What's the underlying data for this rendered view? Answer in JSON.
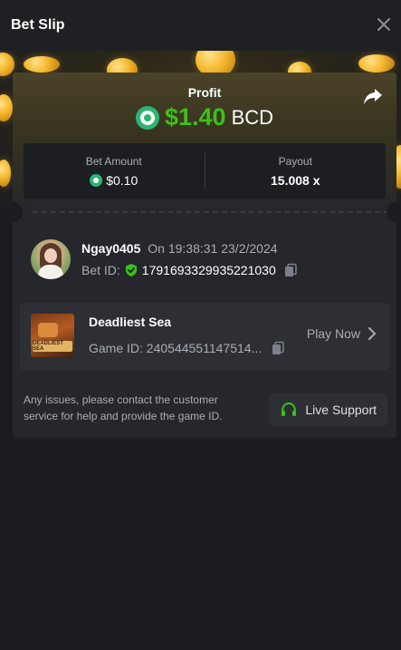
{
  "header": {
    "title": "Bet Slip"
  },
  "profit": {
    "label": "Profit",
    "value": "$1.40",
    "currency": "BCD"
  },
  "stats": {
    "bet_amount_label": "Bet Amount",
    "bet_amount_value": "$0.10",
    "payout_label": "Payout",
    "payout_value": "15.008 x"
  },
  "user": {
    "name": "Ngay0405",
    "time": "On 19:38:31 23/2/2024",
    "bet_id_label": "Bet ID:",
    "bet_id_value": "1791693329935221030"
  },
  "game": {
    "title": "Deadliest Sea",
    "id_text": "Game ID: 240544551147514...",
    "thumb_text": "DEADLIEST SEA",
    "play_label": "Play Now"
  },
  "footer": {
    "notice": "Any issues, please contact the customer service for help and provide the game ID.",
    "support_label": "Live Support"
  },
  "colors": {
    "profit_green": "#3bc117",
    "coin_green": "#2bb673",
    "support_green": "#3bc117"
  },
  "icons": [
    "close-icon",
    "share-icon",
    "bcd-coin-icon",
    "shield-check-icon",
    "copy-icon",
    "chevron-right-icon",
    "headset-icon"
  ]
}
